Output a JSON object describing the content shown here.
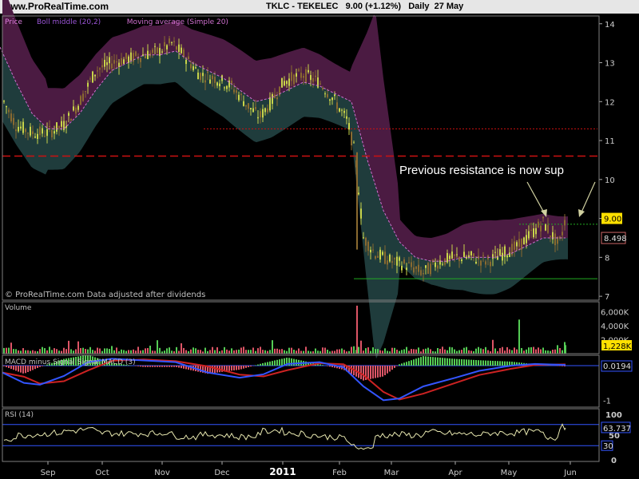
{
  "header": {
    "site": "www.ProRealTime.com",
    "ticker_title": "TKLC - TEKELEC",
    "last_change": "9.00 (+1.12%)",
    "period_date": "Daily  27 May"
  },
  "price_panel": {
    "legend": [
      "Price",
      "Boll middle (20,2)",
      "Moving average (Simple 20)"
    ],
    "legend_colors": [
      "#e07fe0",
      "#9a55d6",
      "#d070d0"
    ],
    "copyright": "© ProRealTime.com  Data adjusted after dividends",
    "annotation": "Previous resistance is now sup",
    "price_tag": "9.00",
    "ma_tag": "8.498"
  },
  "volume_panel": {
    "title": "Volume",
    "tag": "1,228K"
  },
  "macd_panel": {
    "title": "MACD minus Signal  Signal  MACD (3)",
    "tag": "0.0194"
  },
  "rsi_panel": {
    "title": "RSI (14)",
    "tag": "63.737",
    "tag_low": "30"
  },
  "colors": {
    "background": "#000000",
    "band_upper": "#4b1b42",
    "band_lower": "#1f3c3c",
    "candle_up": "#c8d44a",
    "candle_down": "#8a6a30",
    "moving_average": "#d070d0",
    "resistance_red": "#cc1111",
    "support_green": "#22aa22",
    "volume_up": "#55cc55",
    "volume_down": "#dd5566",
    "macd_line": "#3355ff",
    "signal_line": "#cc2222",
    "rsi_line": "#e8e8b0",
    "grid_frame": "#808080",
    "tag_yellow": "#ffe000"
  },
  "chart_data": [
    {
      "type": "line",
      "panel": "price",
      "title": "",
      "x_ticks": [
        "Sep",
        "Oct",
        "Nov",
        "Dec",
        "2011",
        "Feb",
        "Mar",
        "Apr",
        "May",
        "Jun"
      ],
      "y_ticks": [
        7,
        8,
        9,
        10,
        11,
        12,
        13,
        14
      ],
      "ylim": [
        6.9,
        14.2
      ],
      "series": [
        {
          "name": "Price",
          "points": [
            [
              0,
              12.2
            ],
            [
              20,
              11.4
            ],
            [
              40,
              11.2
            ],
            [
              60,
              11.2
            ],
            [
              80,
              11.4
            ],
            [
              100,
              12.0
            ],
            [
              120,
              12.8
            ],
            [
              140,
              13.0
            ],
            [
              160,
              13.1
            ],
            [
              180,
              13.2
            ],
            [
              200,
              13.3
            ],
            [
              215,
              13.5
            ],
            [
              230,
              13.2
            ],
            [
              250,
              12.7
            ],
            [
              270,
              12.6
            ],
            [
              290,
              12.4
            ],
            [
              310,
              11.9
            ],
            [
              325,
              11.6
            ],
            [
              340,
              12.0
            ],
            [
              355,
              12.5
            ],
            [
              365,
              12.6
            ],
            [
              380,
              12.7
            ],
            [
              400,
              12.5
            ],
            [
              420,
              12.0
            ],
            [
              435,
              11.5
            ],
            [
              445,
              10.6
            ],
            [
              455,
              8.5
            ],
            [
              470,
              8.1
            ],
            [
              490,
              7.9
            ],
            [
              510,
              7.8
            ],
            [
              530,
              7.6
            ],
            [
              550,
              7.9
            ],
            [
              570,
              8.0
            ],
            [
              590,
              8.0
            ],
            [
              610,
              7.9
            ],
            [
              630,
              8.1
            ],
            [
              650,
              8.3
            ],
            [
              670,
              8.7
            ],
            [
              680,
              8.9
            ],
            [
              690,
              8.6
            ],
            [
              700,
              8.3
            ],
            [
              708,
              9.0
            ]
          ]
        },
        {
          "name": "Moving average (Simple 20)",
          "points": [
            [
              0,
              13.4
            ],
            [
              20,
              12.5
            ],
            [
              40,
              11.7
            ],
            [
              60,
              11.3
            ],
            [
              80,
              11.3
            ],
            [
              100,
              11.7
            ],
            [
              120,
              12.3
            ],
            [
              140,
              12.8
            ],
            [
              160,
              13.0
            ],
            [
              180,
              13.2
            ],
            [
              200,
              13.2
            ],
            [
              220,
              13.3
            ],
            [
              240,
              13.0
            ],
            [
              260,
              12.8
            ],
            [
              280,
              12.6
            ],
            [
              300,
              12.3
            ],
            [
              320,
              12.0
            ],
            [
              340,
              12.1
            ],
            [
              360,
              12.3
            ],
            [
              380,
              12.5
            ],
            [
              400,
              12.4
            ],
            [
              420,
              12.2
            ],
            [
              440,
              12.0
            ],
            [
              460,
              10.5
            ],
            [
              480,
              9.2
            ],
            [
              500,
              8.4
            ],
            [
              520,
              8.0
            ],
            [
              540,
              7.9
            ],
            [
              560,
              7.9
            ],
            [
              580,
              8.0
            ],
            [
              600,
              8.0
            ],
            [
              620,
              8.0
            ],
            [
              640,
              8.1
            ],
            [
              660,
              8.3
            ],
            [
              680,
              8.5
            ],
            [
              700,
              8.5
            ],
            [
              708,
              8.5
            ]
          ]
        }
      ],
      "reference_lines": [
        {
          "value": 11.3,
          "style": "dotted",
          "color": "#cc1111"
        },
        {
          "value": 10.6,
          "style": "dashed",
          "color": "#cc1111"
        },
        {
          "value": 8.85,
          "style": "dotted",
          "color": "#22aa22"
        },
        {
          "value": 7.45,
          "style": "solid",
          "color": "#22aa22"
        }
      ]
    },
    {
      "type": "bar",
      "panel": "volume",
      "title": "Volume",
      "y_ticks": [
        "2,000K",
        "4,000K",
        "6,000K"
      ],
      "ylim": [
        0,
        7000000
      ],
      "notable_values": [
        {
          "x": 447,
          "value": 6900000
        },
        {
          "x": 650,
          "value": 4900000
        },
        {
          "x": 708,
          "value": 1228000
        }
      ]
    },
    {
      "type": "line",
      "panel": "macd",
      "title": "MACD minus Signal  Signal  MACD (3)",
      "y_ticks": [
        "0",
        "-1"
      ],
      "ylim": [
        -1.2,
        0.3
      ],
      "last_value": 0.0194
    },
    {
      "type": "line",
      "panel": "rsi",
      "title": "RSI (14)",
      "y_ticks": [
        0,
        50,
        100
      ],
      "ylim": [
        0,
        100
      ],
      "levels": [
        30,
        70
      ],
      "last_value": 63.737
    }
  ]
}
